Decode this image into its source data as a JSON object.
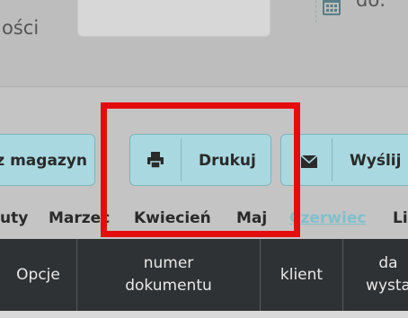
{
  "top": {
    "left_text": "ości",
    "right_text": "do:"
  },
  "icons": {
    "calendar": "calendar-icon",
    "print": "printer-icon",
    "send": "envelope-icon"
  },
  "buttons": {
    "warehouse_label": "rz magazyn",
    "print_label": "Drukuj",
    "send_label": "Wyślij"
  },
  "months": [
    "uty",
    "Marzec",
    "Kwiecień",
    "Maj",
    "Czerwiec",
    "Li"
  ],
  "active_month": "Czerwiec",
  "table": {
    "headers": [
      "Opcje",
      "numer\ndokumentu",
      "klient",
      "da\nwysta"
    ]
  },
  "colors": {
    "button_bg": "#a9d8e0",
    "header_bg": "#2f3235",
    "highlight": "#e40d0d",
    "active_month": "#7fc0cc"
  }
}
